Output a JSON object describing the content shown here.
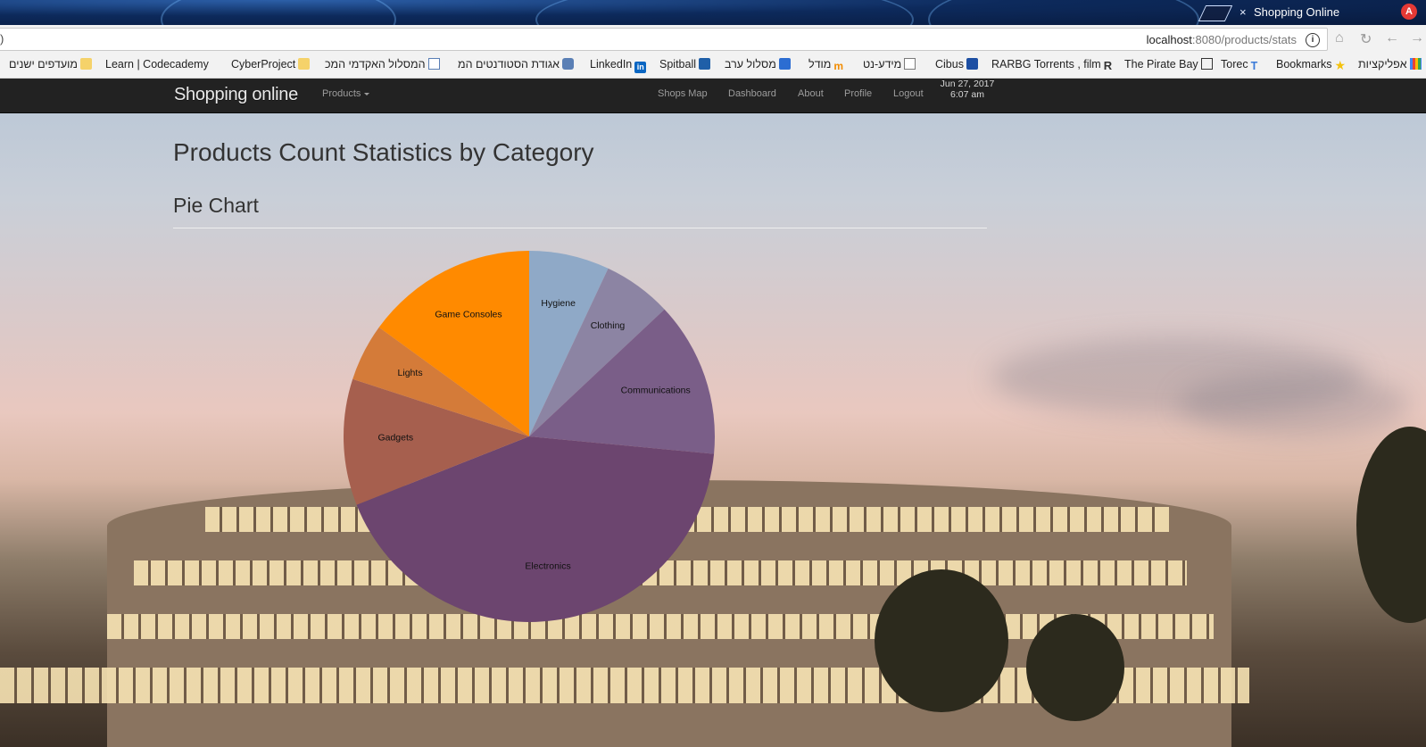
{
  "browser": {
    "tab_title": "Shopping Online",
    "tab_close": "×",
    "profile_letter": "A",
    "url_host": "localhost",
    "url_path": ":8080/products/stats",
    "url_stub": ")"
  },
  "bookmarks": [
    {
      "label": "מועדפים ישנים",
      "icon": "folder-icon",
      "color": "#f5d26a"
    },
    {
      "label": "Learn | Codecademy",
      "icon": "codecademy-icon",
      "color": "#f2f2f2"
    },
    {
      "label": "CyberProject",
      "icon": "folder-icon",
      "color": "#f5d26a"
    },
    {
      "label": "המסלול האקדמי המכ",
      "icon": "college-icon",
      "color": "#e0e0e0"
    },
    {
      "label": "אגודת הסטודנטים המ",
      "icon": "students-icon",
      "color": "#5a7fb5"
    },
    {
      "label": "LinkedIn",
      "icon": "linkedin-icon",
      "color": "#0a66c2"
    },
    {
      "label": "Spitball",
      "icon": "spitball-icon",
      "color": "#1f5fa8"
    },
    {
      "label": "מסלול ערב",
      "icon": "evening-track-icon",
      "color": "#2c6dd2"
    },
    {
      "label": "מודל",
      "icon": "moodle-icon",
      "color": "#f28c00"
    },
    {
      "label": "מידע-נט",
      "icon": "meida-net-icon",
      "color": "#e0e0e0"
    },
    {
      "label": "Cibus",
      "icon": "cibus-icon",
      "color": "#1d4fa3"
    },
    {
      "label": "RARBG Torrents , film",
      "icon": "rarbg-icon",
      "color": "#333333"
    },
    {
      "label": "The Pirate Bay",
      "icon": "piratebay-icon",
      "color": "#333333"
    },
    {
      "label": "Torec",
      "icon": "torec-icon",
      "color": "#3a7ad8"
    },
    {
      "label": "Bookmarks",
      "icon": "star-icon",
      "color": "#f4c20d"
    },
    {
      "label": "אפליקציות",
      "icon": "apps-grid-icon",
      "color": "#4285f4"
    }
  ],
  "navbar": {
    "brand": "Shopping online",
    "products_label": "Products",
    "links": [
      "Shops Map",
      "Dashboard",
      "About",
      "Profile",
      "Logout"
    ],
    "date": "Jun 27, 2017",
    "time": "6:07 am"
  },
  "page": {
    "title": "Products Count Statistics by Category",
    "subtitle": "Pie Chart"
  },
  "colors": {
    "navbar_bg": "#222222",
    "nav_text": "#9d9d9d"
  },
  "chart_data": {
    "type": "pie",
    "title": "",
    "unit": "",
    "start_angle_deg": 0,
    "direction": "clockwise",
    "slices": [
      {
        "label": "Hygiene",
        "value": 7,
        "color": "#8fa9c7"
      },
      {
        "label": "Clothing",
        "value": 6,
        "color": "#8c84a3"
      },
      {
        "label": "Communications",
        "value": 13.5,
        "color": "#7a5e88"
      },
      {
        "label": "Electronics",
        "value": 42.5,
        "color": "#6c456f"
      },
      {
        "label": "Gadgets",
        "value": 11,
        "color": "#a65f4e"
      },
      {
        "label": "Lights",
        "value": 5,
        "color": "#d47b39"
      },
      {
        "label": "Game Consoles",
        "value": 15,
        "color": "#ff8a00"
      }
    ]
  }
}
